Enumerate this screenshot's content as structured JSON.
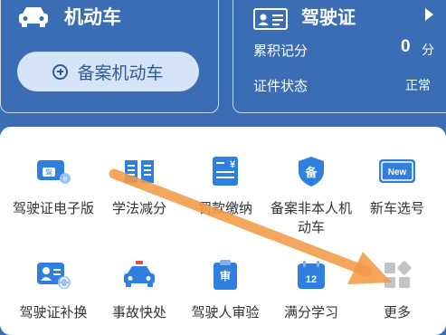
{
  "vehicle": {
    "title": "机动车",
    "register_button": "备案机动车"
  },
  "license": {
    "title": "驾驶证",
    "points_label": "累积记分",
    "points_value": "0",
    "points_unit": "分",
    "status_label": "证件状态",
    "status_value": "正常"
  },
  "services": {
    "row1": [
      {
        "label": "驾驶证电子版",
        "icon": "driver-license-card-icon"
      },
      {
        "label": "学法减分",
        "icon": "open-book-icon"
      },
      {
        "label": "罚款缴纳",
        "icon": "fine-receipt-icon"
      },
      {
        "label": "备案非本人机动车",
        "icon": "register-shield-icon"
      },
      {
        "label": "新车选号",
        "icon": "new-plate-icon"
      }
    ],
    "row2": [
      {
        "label": "驾驶证补换",
        "icon": "license-renew-icon"
      },
      {
        "label": "事故快处",
        "icon": "accident-car-icon"
      },
      {
        "label": "驾驶人审验",
        "icon": "inspection-clipboard-icon"
      },
      {
        "label": "满分学习",
        "icon": "calendar-12-icon"
      },
      {
        "label": "更多",
        "icon": "more-grid-icon"
      }
    ]
  },
  "glyphs": {
    "badge_jia": "驾",
    "badge_bei": "备",
    "badge_new": "New",
    "calendar_day": "12",
    "inspect_char": "审",
    "receipt_char": "¥"
  },
  "colors": {
    "background": "#3a6db3",
    "icon_blue": "#2f7fe0",
    "annotation_arrow": "#f39a47"
  }
}
